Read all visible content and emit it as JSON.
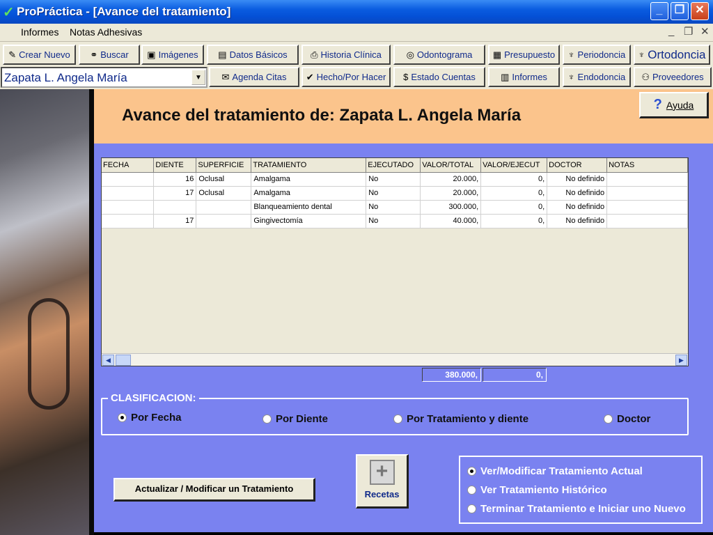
{
  "window": {
    "title": "ProPráctica - [Avance del tratamiento]"
  },
  "menu": {
    "items": [
      "Informes",
      "Notas Adhesivas"
    ]
  },
  "toolbar": {
    "row1": [
      {
        "label": "Crear Nuevo",
        "icon": "new-icon"
      },
      {
        "label": "Buscar",
        "icon": "binoculars-icon"
      },
      {
        "label": "Imágenes",
        "icon": "camera-icon"
      },
      {
        "label": "Datos Básicos",
        "icon": "card-icon"
      },
      {
        "label": "Historia Clínica",
        "icon": "printer-icon"
      },
      {
        "label": "Odontograma",
        "icon": "odontogram-icon"
      },
      {
        "label": "Presupuesto",
        "icon": "budget-icon"
      },
      {
        "label": "Periodoncia",
        "icon": "tooth-icon"
      },
      {
        "label": "Ortodoncia",
        "icon": "tooth-icon"
      }
    ],
    "row2": [
      {
        "label": "Agenda Citas",
        "icon": "agenda-icon"
      },
      {
        "label": "Hecho/Por Hacer",
        "icon": "check-icon"
      },
      {
        "label": "Estado Cuentas",
        "icon": "dollar-icon"
      },
      {
        "label": "Informes",
        "icon": "report-icon"
      },
      {
        "label": "Endodoncia",
        "icon": "tooth-icon"
      },
      {
        "label": "Proveedores",
        "icon": "suppliers-icon"
      }
    ]
  },
  "patient": {
    "selected": "Zapata L. Angela María"
  },
  "header": {
    "title": "Avance del tratamiento de:  Zapata L. Angela María"
  },
  "help": {
    "label": "Ayuda"
  },
  "table": {
    "columns": [
      "FECHA",
      "DIENTE",
      "SUPERFICIE",
      "TRATAMIENTO",
      "EJECUTADO",
      "VALOR/TOTAL",
      "VALOR/EJECUT",
      "DOCTOR",
      "NOTAS"
    ],
    "rows": [
      [
        "",
        "16",
        "Oclusal",
        "Amalgama",
        "No",
        "20.000,",
        "0,",
        "No definido",
        ""
      ],
      [
        "",
        "17",
        "Oclusal",
        "Amalgama",
        "No",
        "20.000,",
        "0,",
        "No definido",
        ""
      ],
      [
        "",
        "",
        "",
        "Blanqueamiento dental",
        "No",
        "300.000,",
        "0,",
        "No definido",
        ""
      ],
      [
        "",
        "17",
        "",
        "Gingivectomía",
        "No",
        "40.000,",
        "0,",
        "No definido",
        ""
      ]
    ]
  },
  "totals": {
    "valor_total": "380.000,",
    "valor_ejecut": "0,"
  },
  "classification": {
    "legend": "CLASIFICACION:",
    "options": [
      "Por Fecha",
      "Por Diente",
      "Por Tratamiento y diente",
      "Doctor"
    ],
    "selected": "Por Fecha"
  },
  "actions": {
    "update_label": "Actualizar / Modificar un Tratamiento",
    "recetas_label": "Recetas"
  },
  "treatment_view": {
    "options": [
      "Ver/Modificar Tratamiento Actual",
      "Ver Tratamiento Histórico",
      "Terminar Tratamiento e Iniciar uno Nuevo"
    ],
    "selected": "Ver/Modificar Tratamiento Actual"
  }
}
